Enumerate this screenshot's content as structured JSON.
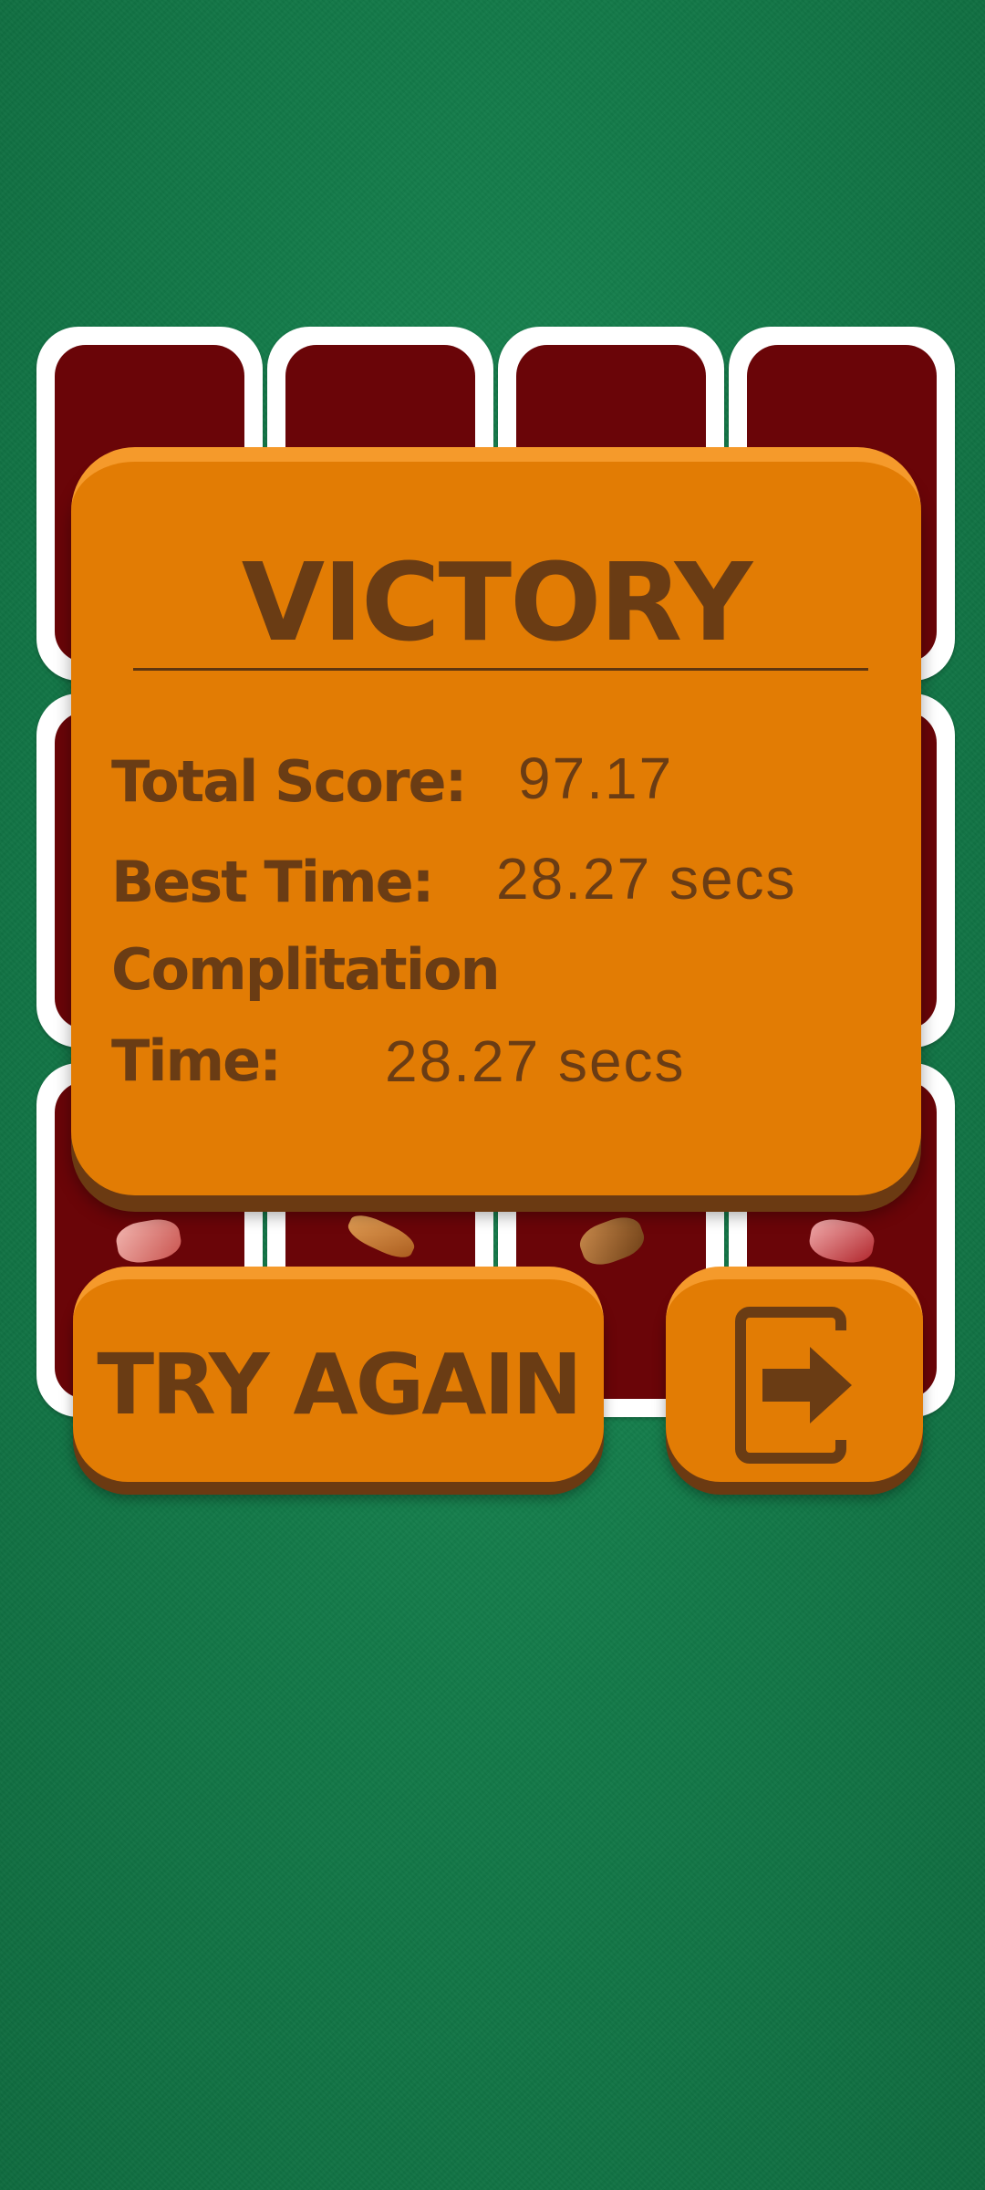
{
  "dialog": {
    "title": "VICTORY",
    "total_score_label": "Total Score:",
    "total_score_value": "97.17",
    "best_time_label": "Best Time:",
    "best_time_value": "28.27 secs",
    "completion_label_line1": "Complitation",
    "completion_label_line2": "Time:",
    "completion_value": "28.27 secs"
  },
  "buttons": {
    "try_again_label": "TRY AGAIN",
    "exit_icon": "exit-icon"
  },
  "colors": {
    "felt_green": "#137a49",
    "card_back": "#6a0508",
    "panel_orange": "#e27c04",
    "text_brown": "#6a3c14"
  }
}
